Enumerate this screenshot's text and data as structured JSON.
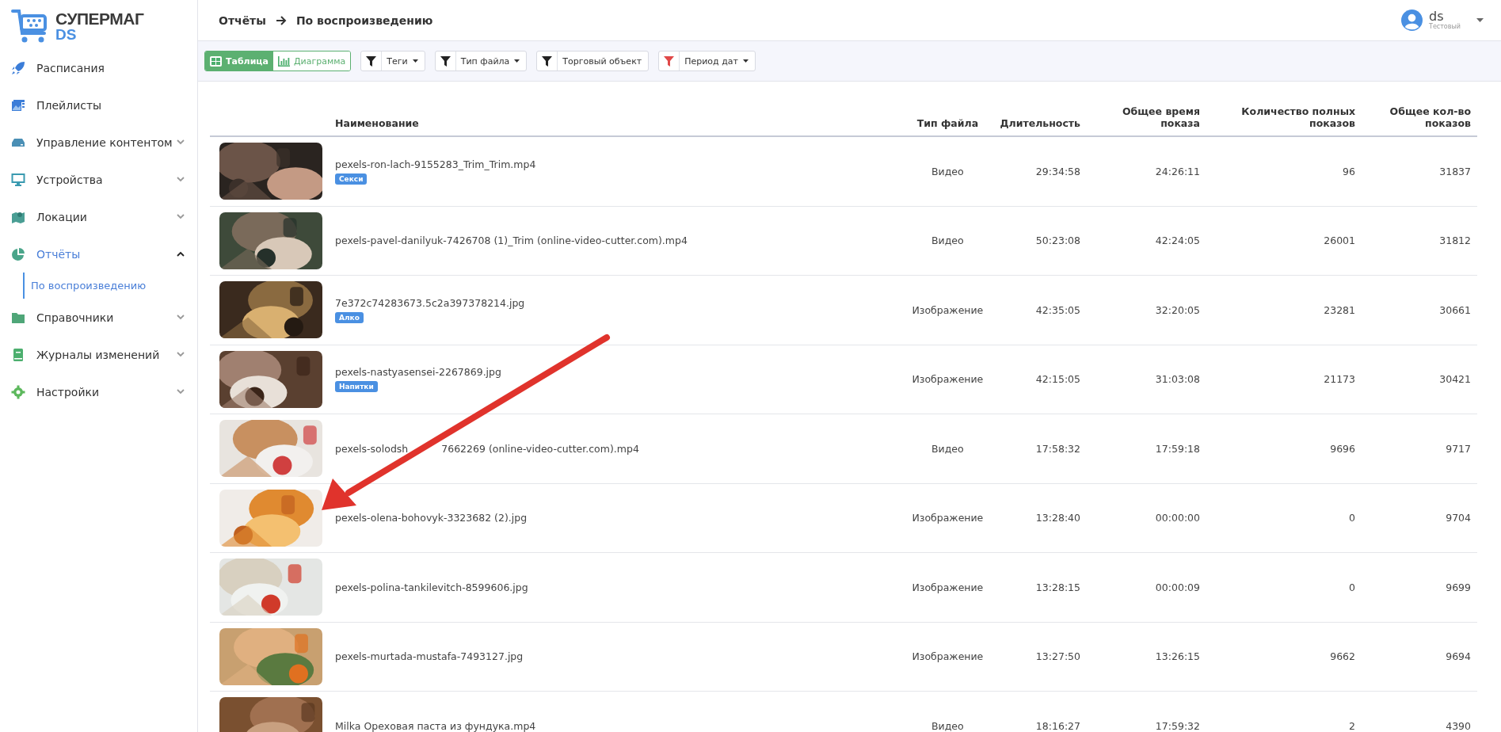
{
  "logo": {
    "title": "СУПЕРМАГ",
    "subtitle": "DS"
  },
  "sidebar": {
    "items": [
      {
        "label": "Расписания",
        "selected": false
      },
      {
        "label": "Плейлисты",
        "selected": false
      },
      {
        "label": "Управление контентом",
        "selected": false,
        "expanded": false
      },
      {
        "label": "Устройства",
        "selected": false,
        "expanded": false
      },
      {
        "label": "Локации",
        "selected": false,
        "expanded": false
      },
      {
        "label": "Отчёты",
        "selected": true,
        "expanded": true,
        "children": [
          {
            "label": "По воспроизведению",
            "selected": true
          }
        ]
      },
      {
        "label": "Справочники",
        "selected": false,
        "expanded": false
      },
      {
        "label": "Журналы изменений",
        "selected": false,
        "expanded": false
      },
      {
        "label": "Настройки",
        "selected": false,
        "expanded": false
      }
    ]
  },
  "breadcrumb": [
    "Отчёты",
    "По воспроизведению"
  ],
  "user": {
    "name": "ds",
    "role": "Тестовый"
  },
  "toolbar": {
    "views": [
      {
        "label": "Таблица",
        "selected": true
      },
      {
        "label": "Диаграмма",
        "selected": false
      }
    ],
    "filters": [
      {
        "label": "Теги",
        "dropdown": true,
        "active": false
      },
      {
        "label": "Тип файла",
        "dropdown": true,
        "active": false
      },
      {
        "label": "Торговый объект",
        "dropdown": false,
        "active": false
      },
      {
        "label": "Период дат",
        "dropdown": true,
        "active": true
      }
    ]
  },
  "table": {
    "columns": [
      "Наименование",
      "Тип файла",
      "Длительность",
      "Общее время показа",
      "Количество полных показов",
      "Общее кол-во показов"
    ],
    "rows": [
      {
        "name": "pexels-ron-lach-9155283_Trim_Trim.mp4",
        "tag": "Секси",
        "type": "Видео",
        "duration": "29:34:58",
        "total_time": "24:26:11",
        "full_count": "96",
        "total_count": "31837"
      },
      {
        "name": "pexels-pavel-danilyuk-7426708 (1)_Trim (online-video-cutter.com).mp4",
        "type": "Видео",
        "duration": "50:23:08",
        "total_time": "42:24:05",
        "full_count": "26001",
        "total_count": "31812"
      },
      {
        "name": "7e372c74283673.5c2a397378214.jpg",
        "tag": "Алко",
        "type": "Изображение",
        "duration": "42:35:05",
        "total_time": "32:20:05",
        "full_count": "23281",
        "total_count": "30661"
      },
      {
        "name": "pexels-nastyasensei-2267869.jpg",
        "tag": "Напитки",
        "type": "Изображение",
        "duration": "42:15:05",
        "total_time": "31:03:08",
        "full_count": "21173",
        "total_count": "30421"
      },
      {
        "name": "pexels-solodsh",
        "name_rest": "7662269 (online-video-cutter.com).mp4",
        "type": "Видео",
        "duration": "17:58:32",
        "total_time": "17:59:18",
        "full_count": "9696",
        "total_count": "9717"
      },
      {
        "name": "pexels-olena-bohovyk-3323682 (2).jpg",
        "type": "Изображение",
        "duration": "13:28:40",
        "total_time": "00:00:00",
        "full_count": "0",
        "total_count": "9704"
      },
      {
        "name": "pexels-polina-tankilevitch-8599606.jpg",
        "type": "Изображение",
        "duration": "13:28:15",
        "total_time": "00:00:09",
        "full_count": "0",
        "total_count": "9699"
      },
      {
        "name": "pexels-murtada-mustafa-7493127.jpg",
        "type": "Изображение",
        "duration": "13:27:50",
        "total_time": "13:26:15",
        "full_count": "9662",
        "total_count": "9694"
      },
      {
        "name": "Milka Ореховая паста из фундука.mp4",
        "type": "Видео",
        "duration": "18:16:27",
        "total_time": "17:59:32",
        "full_count": "2",
        "total_count": "4390"
      }
    ]
  },
  "annotation": {
    "kind": "arrow"
  }
}
